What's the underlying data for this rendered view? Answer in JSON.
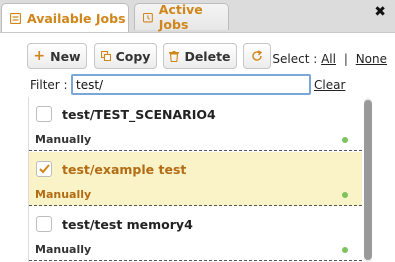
{
  "tabs": [
    {
      "label": "Available Jobs",
      "icon": "list-icon",
      "active": true
    },
    {
      "label": "Active Jobs",
      "icon": "clock-icon",
      "active": false
    }
  ],
  "toolbar": {
    "new_label": "New",
    "copy_label": "Copy",
    "delete_label": "Delete",
    "select_label": "Select :",
    "all_label": "All",
    "separator": "|",
    "none_label": "None"
  },
  "filter": {
    "label": "Filter :",
    "value": "test/",
    "clear_label": "Clear"
  },
  "jobs": [
    {
      "name": "test/TEST_SCENARIO4",
      "mode": "Manually",
      "checked": false
    },
    {
      "name": "test/example test",
      "mode": "Manually",
      "checked": true
    },
    {
      "name": "test/test memory4",
      "mode": "Manually",
      "checked": false
    }
  ],
  "colors": {
    "accent": "#d0861a",
    "selected_row": "#fbf3c8",
    "status_ok": "#7cc35b"
  }
}
